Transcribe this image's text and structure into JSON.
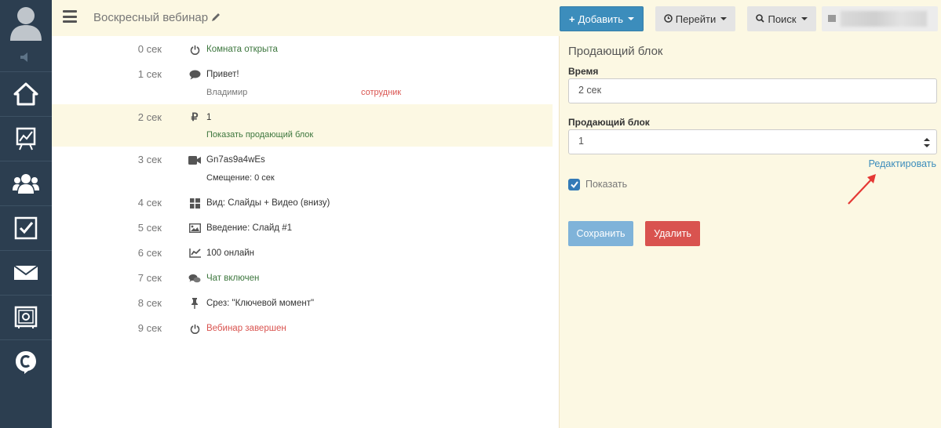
{
  "header": {
    "title": "Воскресный вебинар",
    "add_label": "Добавить",
    "go_label": "Перейти",
    "search_label": "Поиск"
  },
  "timeline": [
    {
      "time": "0 сек",
      "icon": "power-icon",
      "text": "Комната открыта",
      "style": "green"
    },
    {
      "time": "1 сек",
      "icon": "comment-icon",
      "text": "Привет!",
      "author": "Владимир",
      "role": "сотрудник"
    },
    {
      "time": "2 сек",
      "icon": "ruble-icon",
      "text": "1",
      "sub": "Показать продающий блок",
      "highlighted": true
    },
    {
      "time": "3 сек",
      "icon": "video-icon",
      "text": "Gn7as9a4wEs",
      "sub": "Смещение: 0 сек"
    },
    {
      "time": "4 сек",
      "icon": "layout-grid-icon",
      "text": "Вид: Слайды + Видео (внизу)"
    },
    {
      "time": "5 сек",
      "icon": "image-icon",
      "text": "Введение: Слайд #1"
    },
    {
      "time": "6 сек",
      "icon": "chart-line-icon",
      "text": "100 онлайн"
    },
    {
      "time": "7 сек",
      "icon": "comments-icon",
      "text": "Чат включен",
      "style": "green"
    },
    {
      "time": "8 сек",
      "icon": "pin-icon",
      "text": "Срез: \"Ключевой момент\""
    },
    {
      "time": "9 сек",
      "icon": "power-icon",
      "text": "Вебинар завершен",
      "style": "red"
    }
  ],
  "panel": {
    "title": "Продающий блок",
    "time_label": "Время",
    "time_value": "2 сек",
    "block_label": "Продающий блок",
    "block_value": "1",
    "edit_link": "Редактировать",
    "show_label": "Показать",
    "show_checked": true,
    "save_label": "Сохранить",
    "delete_label": "Удалить"
  },
  "colors": {
    "sidebar": "#2c3e50",
    "header_bg": "#fcf8e3",
    "primary": "#3c8dbc",
    "danger": "#d9534f",
    "success_text": "#3c763d"
  }
}
